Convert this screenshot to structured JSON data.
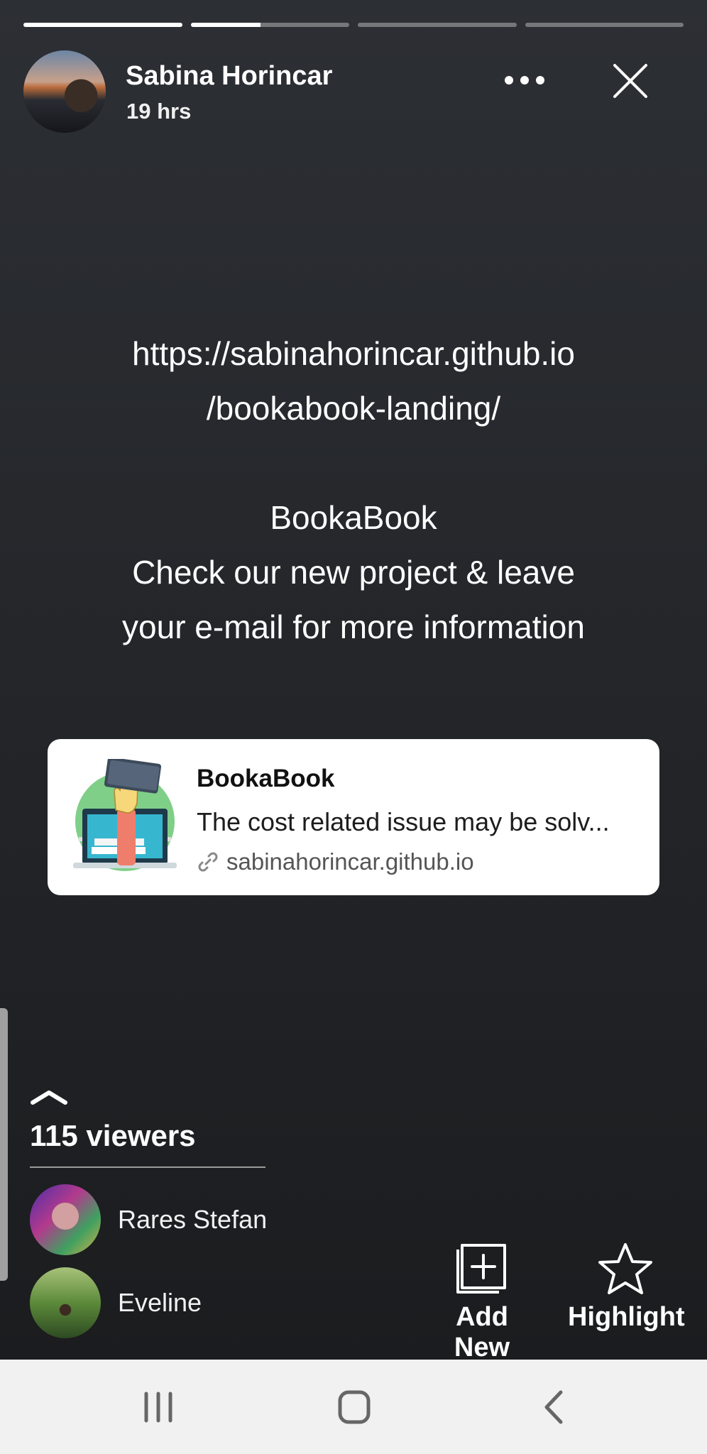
{
  "story": {
    "author_name": "Sabina Horincar",
    "time_ago": "19 hrs",
    "progress": [
      1.0,
      0.44,
      0.0,
      0.0
    ]
  },
  "message": {
    "lines": [
      "https://sabinahorincar.github.io",
      "/bookabook-landing/",
      "",
      "BookaBook",
      "Check our new project & leave",
      "your e-mail for more information"
    ]
  },
  "link_card": {
    "title": "BookaBook",
    "description": "The cost related issue may be solv...",
    "domain": "sabinahorincar.github.io"
  },
  "viewers": {
    "count_label": "115 viewers",
    "list": [
      {
        "name": "Rares Stefan"
      },
      {
        "name": "Eveline"
      }
    ]
  },
  "actions": {
    "add_new_label": "Add New",
    "highlight_label": "Highlight"
  },
  "icons": {
    "more": "more-horizontal-icon",
    "close": "close-icon",
    "link": "link-icon",
    "chevron": "chevron-up-icon",
    "add_new": "add-new-icon",
    "highlight": "star-icon"
  }
}
